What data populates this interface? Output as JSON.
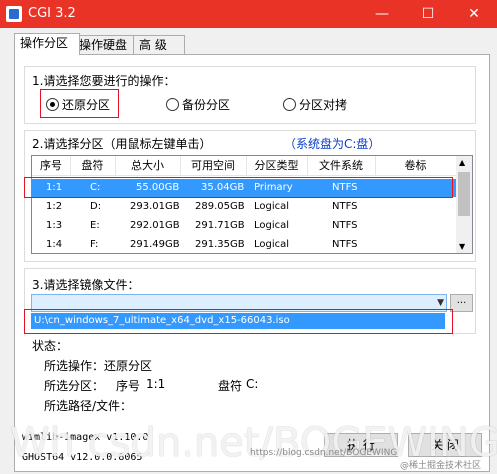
{
  "window": {
    "title": "CGI 3.2",
    "min_glyph": "—",
    "max_glyph": "☐",
    "close_glyph": "✕"
  },
  "tabs": [
    "操作分区",
    "操作硬盘",
    "高 级"
  ],
  "section1": {
    "label": "1.请选择您要进行的操作：",
    "options": [
      "还原分区",
      "备份分区",
      "分区对拷"
    ],
    "selected": 0
  },
  "section2": {
    "label": "2.请选择分区（用鼠标左键单击）",
    "system_note": "（系统盘为C:盘）",
    "columns": [
      "序号",
      "盘符",
      "总大小",
      "可用空间",
      "分区类型",
      "文件系统",
      "卷标"
    ],
    "rows": [
      [
        "1:1",
        "C:",
        "55.00GB",
        "35.04GB",
        "Primary",
        "NTFS",
        ""
      ],
      [
        "1:2",
        "D:",
        "293.01GB",
        "289.05GB",
        "Logical",
        "NTFS",
        ""
      ],
      [
        "1:3",
        "E:",
        "292.01GB",
        "291.71GB",
        "Logical",
        "NTFS",
        ""
      ],
      [
        "1:4",
        "F:",
        "291.49GB",
        "291.35GB",
        "Logical",
        "NTFS",
        ""
      ]
    ],
    "selected_row": 0
  },
  "section3": {
    "label": "3.请选择镜像文件：",
    "combo_value": "",
    "browse_label": "...",
    "dropdown_item": "U:\\cn_windows_7_ultimate_x64_dvd_x15-66043.iso"
  },
  "status": {
    "label": "状态：",
    "operation_label": "所选操作：",
    "operation_value": "还原分区",
    "partition_label": "所选分区：",
    "partition_no_label": "序号",
    "partition_no_value": "1:1",
    "drive_label": "盘符",
    "drive_value": "C:",
    "path_label": "所选路径/文件："
  },
  "footer": {
    "line1": "wimlib-imagex v1.10.0",
    "line2": "GHOST64 v12.0.0.8065",
    "execute_button": "执 行",
    "close_button": "关 闭"
  },
  "watermarks": {
    "main": "Wh  csdn.net/BOGEWING",
    "url": "https://blog.csdn.net/BOGEWING",
    "tag": "@稀土掘金技术社区"
  },
  "colors": {
    "titlebar": "#e83326",
    "selection": "#3399ff",
    "system_note": "#0a3cc8",
    "highlight_border": "#e81123"
  }
}
